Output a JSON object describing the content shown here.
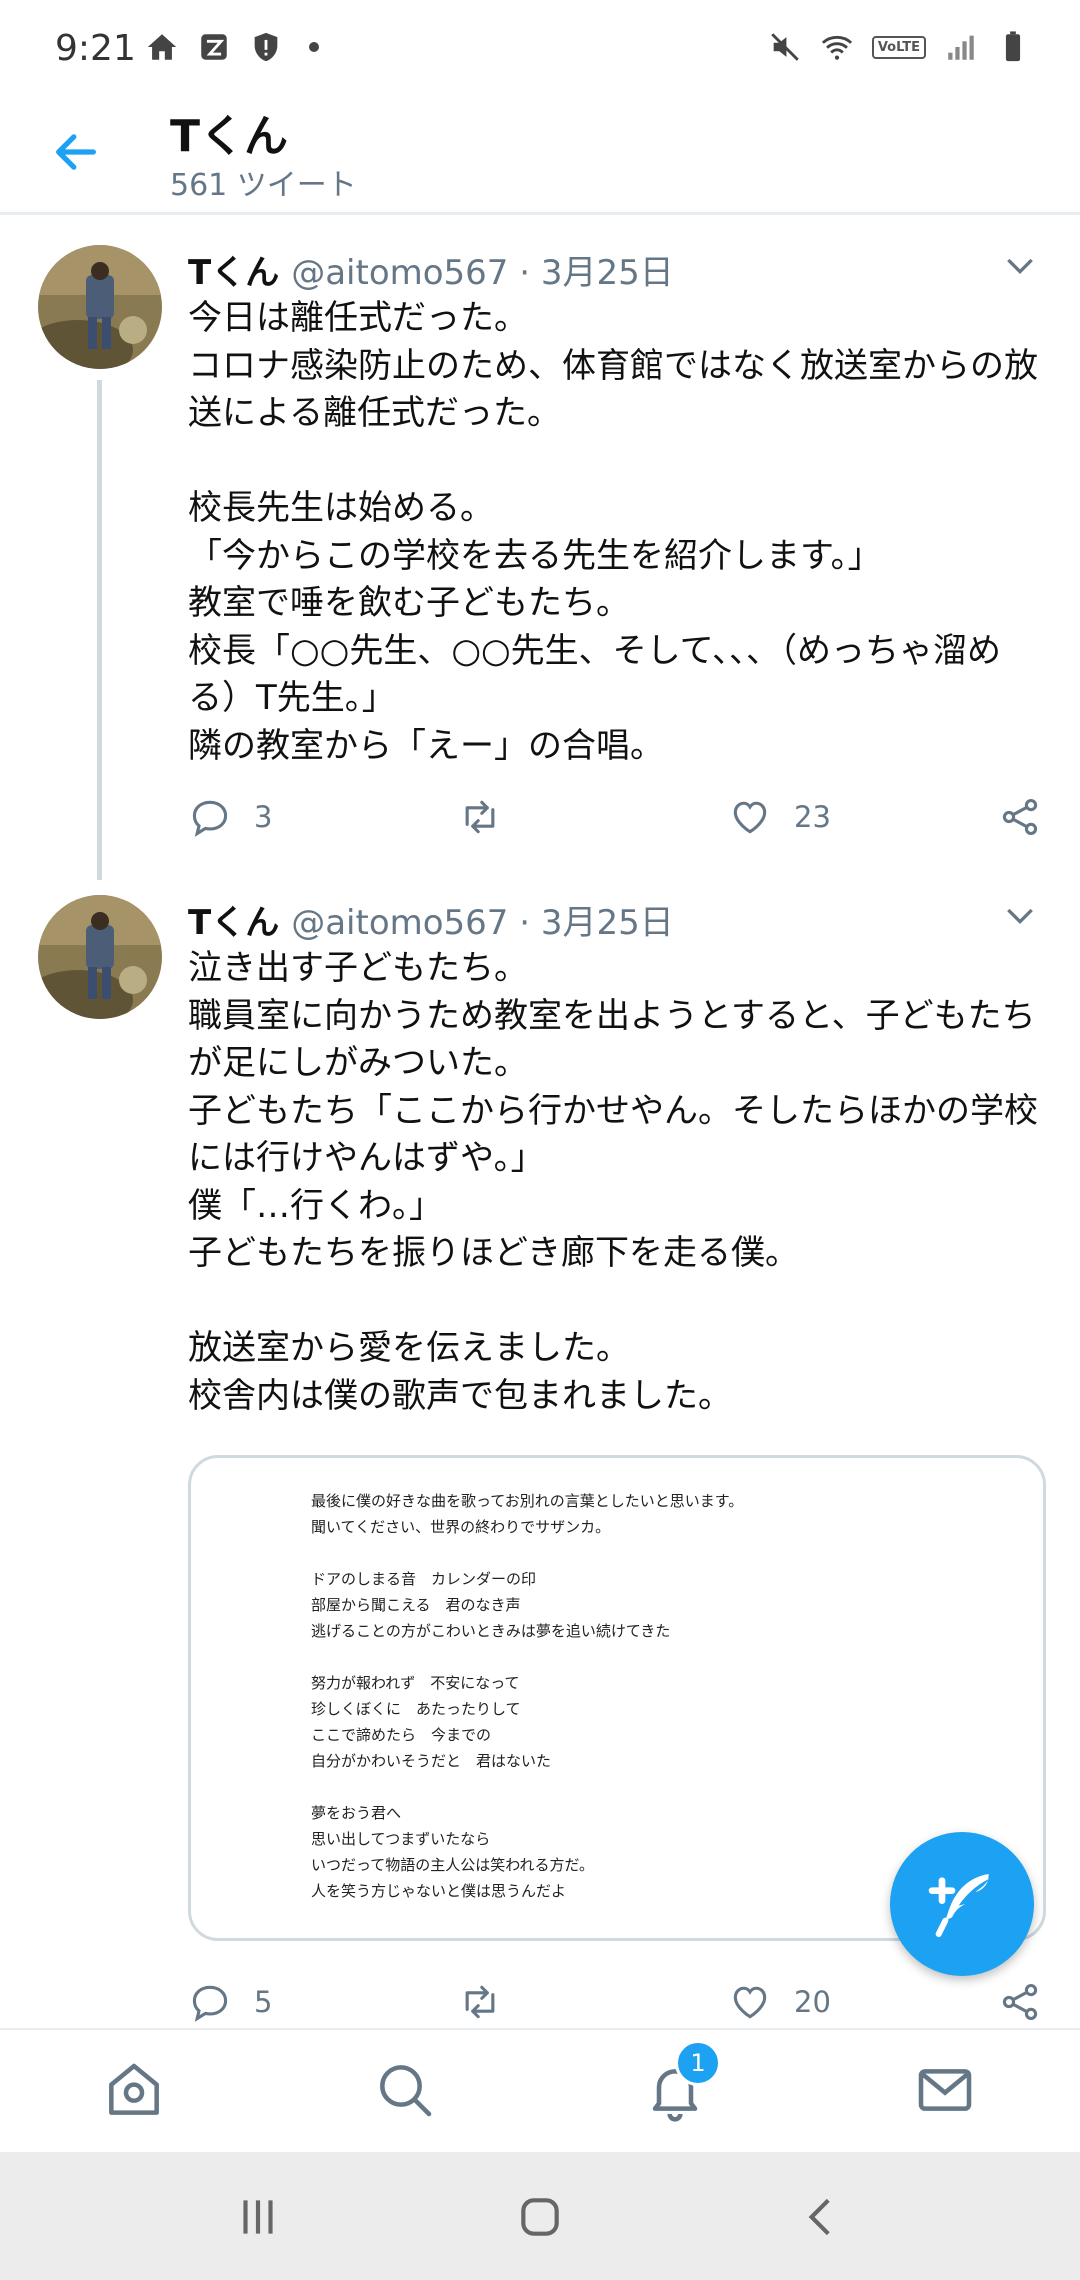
{
  "status_bar": {
    "time": "9:21",
    "network": "VoLTE"
  },
  "header": {
    "title": "Tくん",
    "subtitle": "561 ツイート"
  },
  "tweets": [
    {
      "name": "Tくん",
      "handle": "@aitomo567",
      "separator": "·",
      "date": "3月25日",
      "text": "今日は離任式だった。\nコロナ感染防止のため、体育館ではなく放送室からの放送による離任式だった。\n\n校長先生は始める。\n「今からこの学校を去る先生を紹介します。」\n教室で唾を飲む子どもたち。\n校長「○○先生、○○先生、そして、、、（めっちゃ溜める）T先生。」\n隣の教室から「えー」の合唱。",
      "replies": "3",
      "retweets": "",
      "likes": "23"
    },
    {
      "name": "Tくん",
      "handle": "@aitomo567",
      "separator": "·",
      "date": "3月25日",
      "text": "泣き出す子どもたち。\n職員室に向かうため教室を出ようとすると、子どもたちが足にしがみついた。\n子どもたち「ここから行かせやん。そしたらほかの学校には行けやんはずや。」\n僕「…行くわ。」\n子どもたちを振りほどき廊下を走る僕。\n\n放送室から愛を伝えました。\n校舎内は僕の歌声で包まれました。",
      "image_text": "こう側で会えるかもしれません。\n\n最後に僕の好きな曲を歌ってお別れの言葉としたいと思います。\n聞いてください、世界の終わりでサザンカ。\n\nドアのしまる音　カレンダーの印\n部屋から聞こえる　君のなき声\n逃げることの方がこわいときみは夢を追い続けてきた\n\n努力が報われず　不安になって\n珍しくぼくに　あたったりして\nここで諦めたら　今までの\n自分がかわいそうだと　君はないた\n\n夢をおう君へ\n思い出してつまずいたなら\nいつだって物語の主人公は笑われる方だ。\n人を笑う方じゃないと僕は思うんだよ",
      "replies": "5",
      "retweets": "",
      "likes": "20"
    }
  ],
  "bottom_nav": {
    "notification_count": "1"
  },
  "colors": {
    "accent": "#1da1f2",
    "secondary_text": "#657786",
    "divider": "#e6ecf0"
  },
  "icons": [
    "home-icon",
    "search-icon",
    "notifications-icon",
    "messages-icon",
    "compose-tweet-icon",
    "reply-icon",
    "retweet-icon",
    "like-icon",
    "share-icon",
    "chevron-down-icon",
    "back-arrow-icon"
  ]
}
